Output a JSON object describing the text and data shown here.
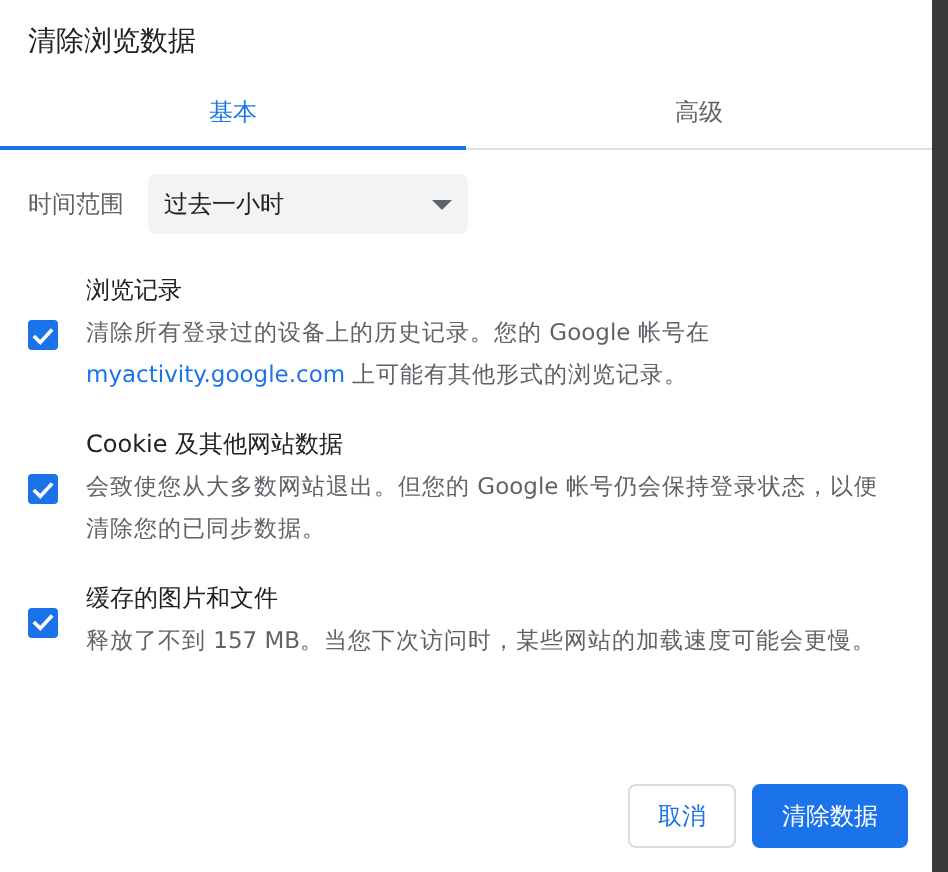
{
  "dialog": {
    "title": "清除浏览数据"
  },
  "tabs": [
    {
      "label": "基本",
      "selected": true
    },
    {
      "label": "高级",
      "selected": false
    }
  ],
  "time_range": {
    "label": "时间范围",
    "value": "过去一小时"
  },
  "items": [
    {
      "title": "浏览记录",
      "checked": true,
      "description": "清除所有登录过的设备上的历史记录。您的 Google 帐号在",
      "link": "myactivity.google.com",
      "description_after": " 上可能有其他形式的浏览记录。"
    },
    {
      "title": "Cookie 及其他网站数据",
      "checked": true,
      "description": "会致使您从大多数网站退出。但您的 Google 帐号仍会保持登录状态，以便清除您的已同步数据。"
    },
    {
      "title": "缓存的图片和文件",
      "checked": true,
      "description": "释放了不到 157 MB。当您下次访问时，某些网站的加载速度可能会更慢。"
    }
  ],
  "buttons": [
    {
      "label": "取消",
      "kind": "secondary"
    },
    {
      "label": "清除数据",
      "kind": "primary"
    }
  ]
}
